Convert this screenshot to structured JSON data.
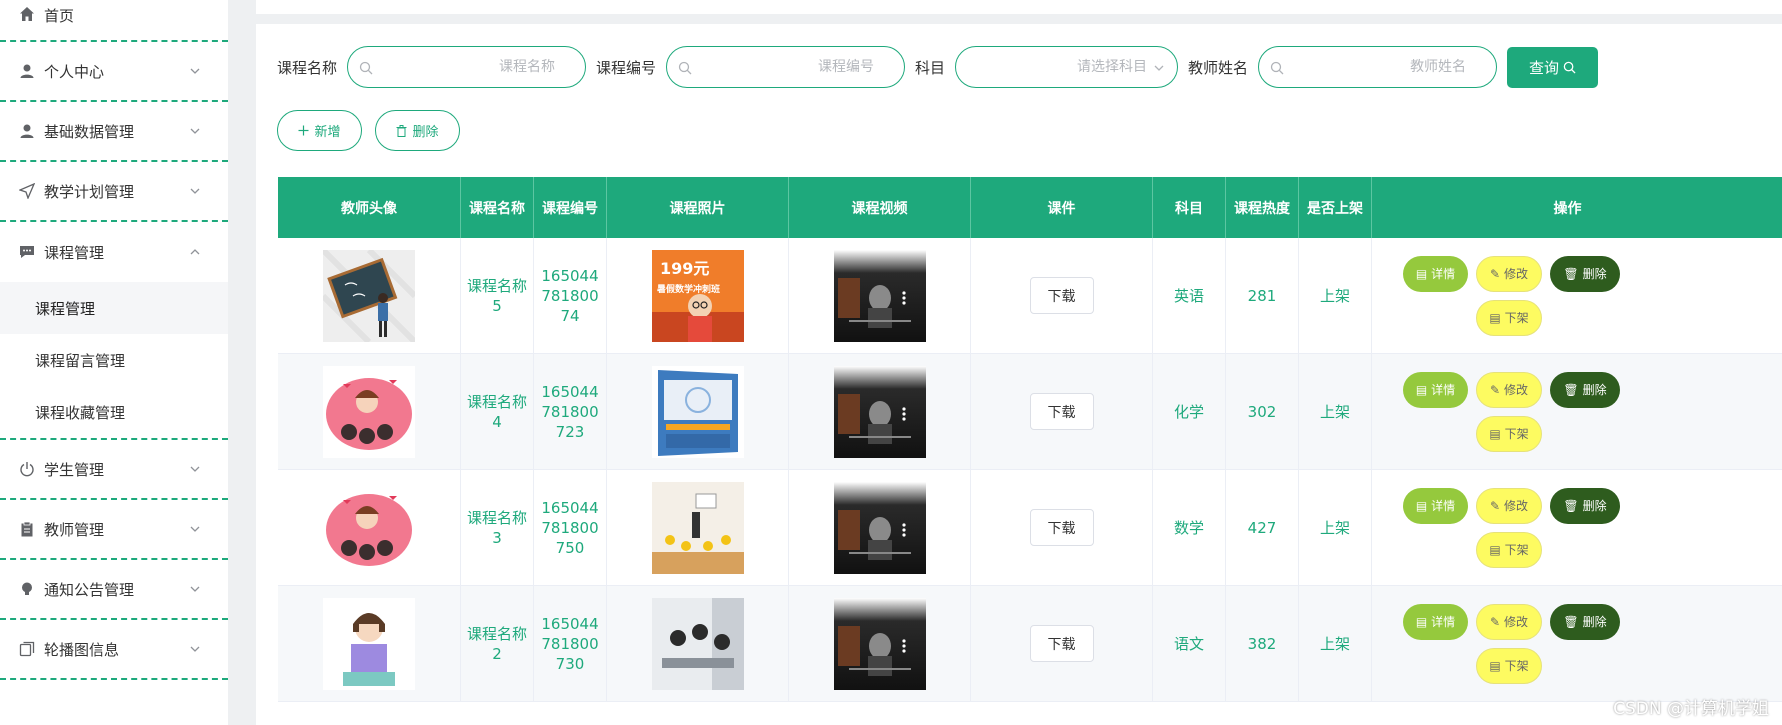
{
  "sidebar": {
    "items": [
      {
        "label": "首页",
        "icon": "home-icon"
      },
      {
        "label": "个人中心",
        "icon": "user-icon"
      },
      {
        "label": "基础数据管理",
        "icon": "user-icon"
      },
      {
        "label": "教学计划管理",
        "icon": "send-icon"
      },
      {
        "label": "课程管理",
        "icon": "chat-icon"
      },
      {
        "label": "学生管理",
        "icon": "power-icon"
      },
      {
        "label": "教师管理",
        "icon": "clipboard-icon"
      },
      {
        "label": "通知公告管理",
        "icon": "bulb-icon"
      },
      {
        "label": "轮播图信息",
        "icon": "copy-icon"
      }
    ],
    "course_sub": [
      "课程管理",
      "课程留言管理",
      "课程收藏管理"
    ]
  },
  "search": {
    "course_name_label": "课程名称",
    "course_name_placeholder": "课程名称",
    "course_no_label": "课程编号",
    "course_no_placeholder": "课程编号",
    "subject_label": "科目",
    "subject_placeholder": "请选择科目",
    "teacher_label": "教师姓名",
    "teacher_placeholder": "教师姓名",
    "query_label": "查询"
  },
  "actions": {
    "add_label": "新增",
    "delete_label": "删除"
  },
  "table": {
    "headers": [
      "教师头像",
      "课程名称",
      "课程编号",
      "课程照片",
      "课程视频",
      "课件",
      "科目",
      "课程热度",
      "是否上架",
      "操作"
    ],
    "rows": [
      {
        "name": "课程名称5",
        "code": "16504478180074",
        "download": "下载",
        "subject": "英语",
        "heat": "281",
        "status": "上架"
      },
      {
        "name": "课程名称4",
        "code": "165044781800723",
        "download": "下载",
        "subject": "化学",
        "heat": "302",
        "status": "上架"
      },
      {
        "name": "课程名称3",
        "code": "165044781800750",
        "download": "下载",
        "subject": "数学",
        "heat": "427",
        "status": "上架"
      },
      {
        "name": "课程名称2",
        "code": "165044781800730",
        "download": "下载",
        "subject": "语文",
        "heat": "382",
        "status": "上架"
      }
    ],
    "op_labels": {
      "detail": "详情",
      "edit": "修改",
      "delete": "删除",
      "off": "下架"
    }
  },
  "photo_texts": {
    "price": "199元",
    "banner": "暑假数学冲刺班"
  },
  "watermark": "CSDN @计算机学姐",
  "colors": {
    "primary": "#1ea97c",
    "detail": "#95c93d",
    "edit": "#fdfb61",
    "delete": "#2e5c1e"
  }
}
